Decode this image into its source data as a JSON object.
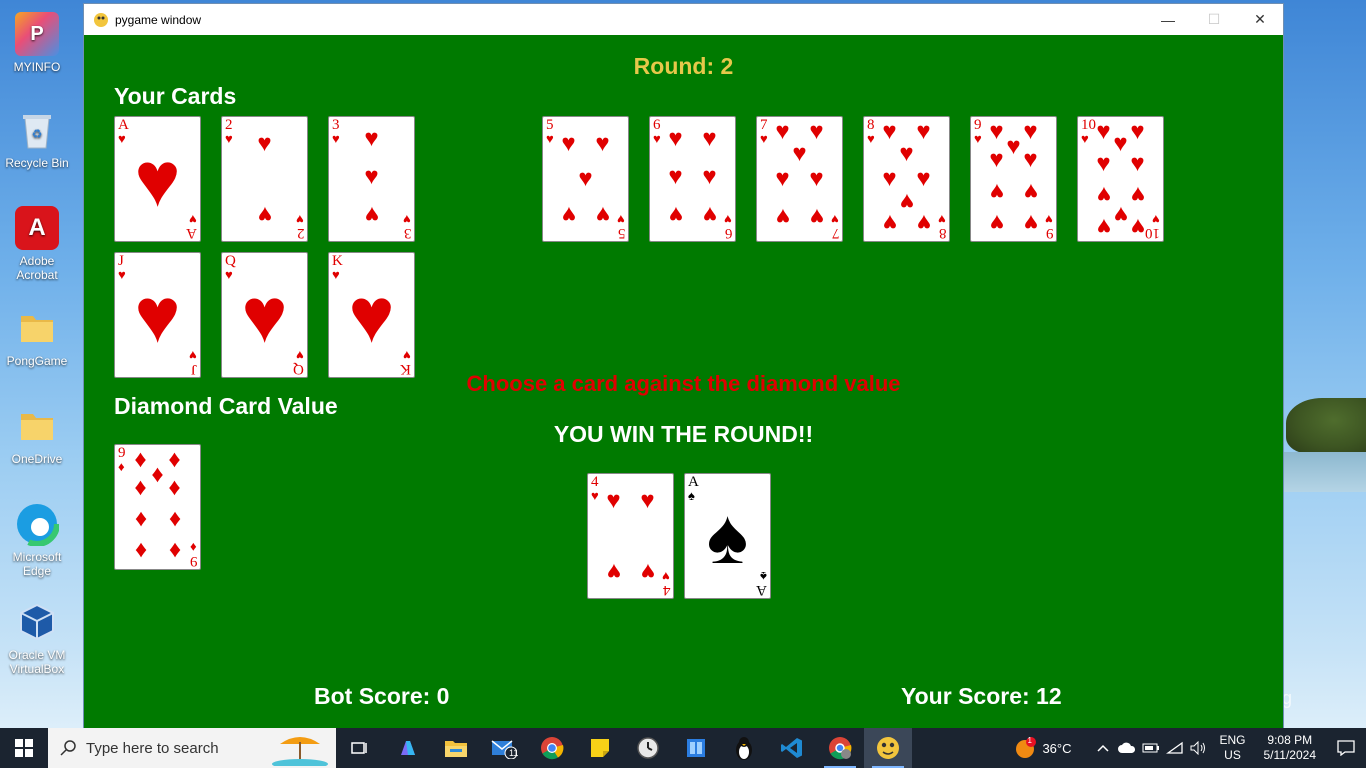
{
  "desktop": {
    "icons": [
      {
        "label": "MYINFO"
      },
      {
        "label": "Recycle Bin"
      },
      {
        "label": "Adobe Acrobat"
      },
      {
        "label": "PongGame"
      },
      {
        "label": "OneDrive"
      },
      {
        "label": "Microsoft Edge"
      },
      {
        "label": "Oracle VM VirtualBox"
      }
    ]
  },
  "window": {
    "title": "pygame window",
    "controls": {
      "minimize": "—",
      "maximize": "☐",
      "close": "✕"
    }
  },
  "game": {
    "round_text": "Round: 2",
    "your_cards_label": "Your Cards",
    "diamond_label": "Diamond Card Value",
    "instruction": "Choose a card against the diamond value",
    "result": "YOU WIN THE ROUND!!",
    "bot_score": "Bot Score: 0",
    "your_score": "Your Score: 12",
    "hand": [
      {
        "rank": "A",
        "suit": "♥",
        "color": "red"
      },
      {
        "rank": "2",
        "suit": "♥",
        "color": "red"
      },
      {
        "rank": "3",
        "suit": "♥",
        "color": "red"
      },
      {
        "rank": "5",
        "suit": "♥",
        "color": "red"
      },
      {
        "rank": "6",
        "suit": "♥",
        "color": "red"
      },
      {
        "rank": "7",
        "suit": "♥",
        "color": "red"
      },
      {
        "rank": "8",
        "suit": "♥",
        "color": "red"
      },
      {
        "rank": "9",
        "suit": "♥",
        "color": "red"
      },
      {
        "rank": "10",
        "suit": "♥",
        "color": "red"
      },
      {
        "rank": "J",
        "suit": "♥",
        "color": "red"
      },
      {
        "rank": "Q",
        "suit": "♥",
        "color": "red"
      },
      {
        "rank": "K",
        "suit": "♥",
        "color": "red"
      }
    ],
    "diamond_card": {
      "rank": "9",
      "suit": "♦",
      "color": "red"
    },
    "played": [
      {
        "rank": "4",
        "suit": "♥",
        "color": "red"
      },
      {
        "rank": "A",
        "suit": "♠",
        "color": "black"
      }
    ]
  },
  "taskbar": {
    "search_placeholder": "Type here to search",
    "pinned": [
      "task-view",
      "copilot",
      "file-explorer",
      "mail",
      "chrome",
      "sticky-notes",
      "clock-app",
      "store",
      "linux",
      "vscode",
      "chrome-profile",
      "pygame"
    ],
    "mail_badge": "11",
    "weather": "36°C",
    "weather_badge": "1",
    "lang_top": "ENG",
    "lang_bottom": "US",
    "time": "9:08 PM",
    "date": "5/11/2024"
  },
  "colors": {
    "felt": "#007a00",
    "round_text": "#e6c84a",
    "instruction": "#e00000",
    "card_red": "#e00000"
  }
}
